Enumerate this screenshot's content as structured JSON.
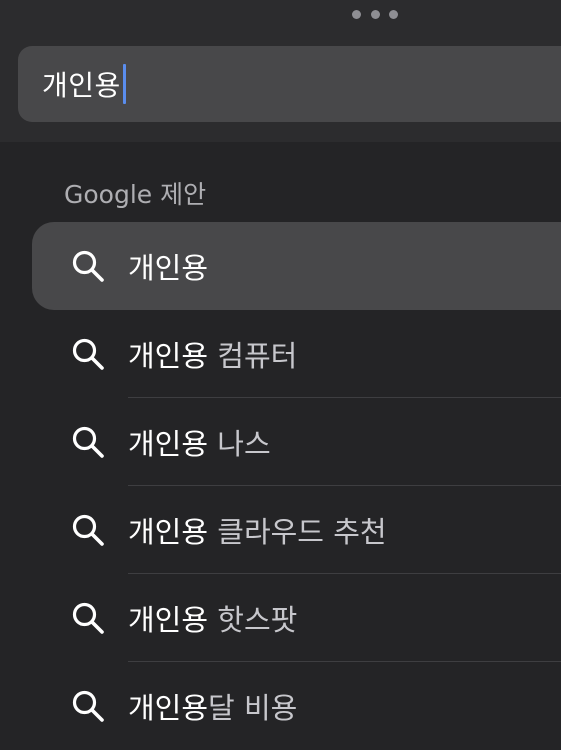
{
  "search": {
    "value": "개인용"
  },
  "section": {
    "header": "Google 제안"
  },
  "suggestions": [
    {
      "typed": "개인용",
      "rest": ""
    },
    {
      "typed": "개인용",
      "rest": " 컴퓨터"
    },
    {
      "typed": "개인용",
      "rest": " 나스"
    },
    {
      "typed": "개인용",
      "rest": " 클라우드 추천"
    },
    {
      "typed": "개인용",
      "rest": " 핫스팟"
    },
    {
      "typed": "개인용",
      "rest": "달 비용"
    }
  ],
  "icons": {
    "more": "more-dots-icon",
    "search": "search-icon"
  },
  "colors": {
    "background": "#242426",
    "field": "#48484a",
    "caret": "#5a8dee"
  }
}
